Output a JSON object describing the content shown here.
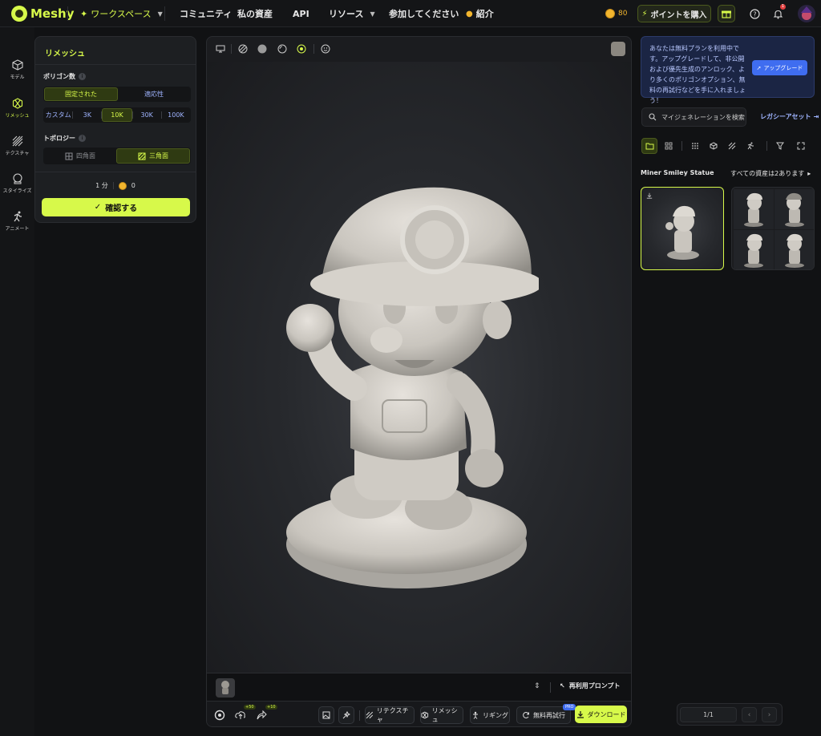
{
  "brand": {
    "name": "Meshy",
    "accent": "#d7f94a"
  },
  "nav": {
    "workspace": "ワークスペース",
    "community": "コミュニティ",
    "my_assets": "私の資産",
    "api": "API",
    "resources": "リソース",
    "join": "参加してください",
    "referral": "紹介"
  },
  "account": {
    "credits": "80",
    "buy_points": "ポイントを購入",
    "notification_count": "1"
  },
  "left_nav": [
    {
      "label": "モデル",
      "icon": "cube-icon"
    },
    {
      "label": "リメッシュ",
      "icon": "remesh-icon"
    },
    {
      "label": "テクスチャ",
      "icon": "texture-icon"
    },
    {
      "label": "スタイライズ",
      "icon": "stylize-icon"
    },
    {
      "label": "アニメート",
      "icon": "animate-icon"
    }
  ],
  "remesh_panel": {
    "title": "リメッシュ",
    "polygon_label": "ポリゴン数",
    "mode_fixed": "固定された",
    "mode_adaptive": "適応性",
    "counts": [
      "カスタム",
      "3K",
      "10K",
      "30K",
      "100K"
    ],
    "selected_count": "10K",
    "topology_label": "トポロジー",
    "topology_quad": "四角面",
    "topology_tri": "三角面",
    "time_estimate": "1 分",
    "cost": "0",
    "confirm": "確認する"
  },
  "viewer": {
    "reuse_prompt": "再利用プロンプト",
    "tools": {
      "retexture": "リテクスチャ",
      "remesh": "リメッシュ",
      "rigging": "リギング",
      "free_retry": "無料再試行",
      "download": "ダウンロード",
      "pro_badge": "PRO",
      "upload_credit": "+50",
      "share_credit": "+10"
    }
  },
  "upsell": {
    "text": "あなたは無料プランを利用中です。アップグレードして、非公開および優先生成のアンロック、より多くのポリゴンオプション、無料の再試行などを手に入れましょう！",
    "button": "アップグレード"
  },
  "assets": {
    "search_placeholder": "マイジェネレーションを検索",
    "legacy": "レガシーアセット",
    "title": "Miner Smiley Statue",
    "count_text": "すべての資産は2あります",
    "page": "1/1"
  },
  "colors": {
    "background": "#111214",
    "panel": "#1d1f22",
    "selected_bg": "#2f3a12",
    "link": "#9fb4ff",
    "upgrade": "#3f6df0"
  }
}
